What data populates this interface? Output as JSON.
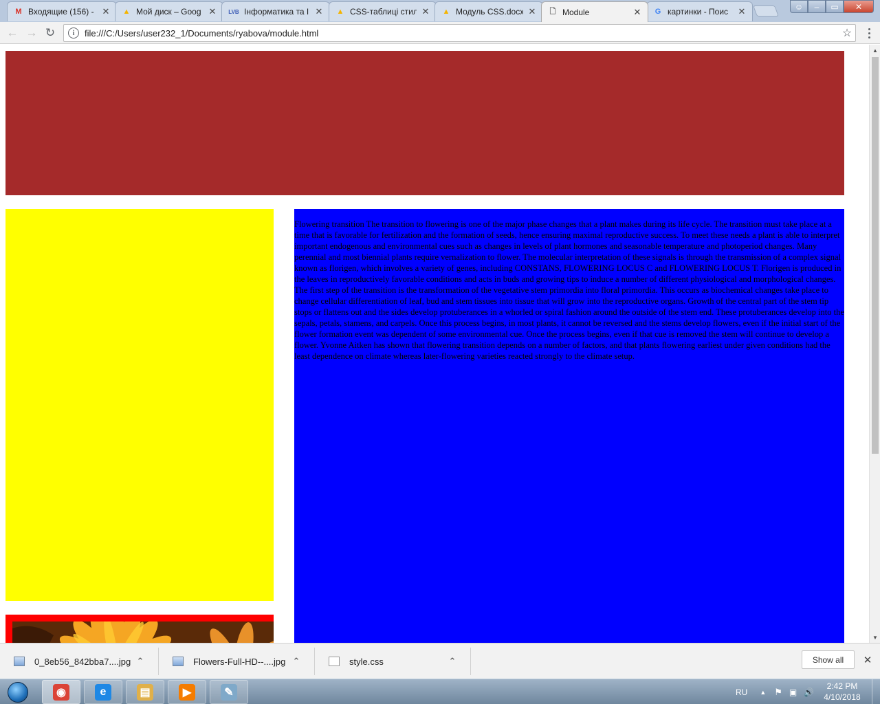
{
  "browser": {
    "tabs": [
      {
        "title": "Входящие (156) -",
        "favicon": "gmail-icon",
        "fav_char": "M",
        "fav_color": "#d93025"
      },
      {
        "title": "Мой диск – Goog",
        "favicon": "google-drive-icon",
        "fav_char": "▲",
        "fav_color": "#f4b400"
      },
      {
        "title": "Інформатика та І",
        "favicon": "lvb-icon",
        "fav_char": "LVB",
        "fav_color": "#3b5bb5"
      },
      {
        "title": "CSS-таблиці стил",
        "favicon": "google-drive-icon",
        "fav_char": "▲",
        "fav_color": "#f4b400"
      },
      {
        "title": "Модуль CSS.docx",
        "favicon": "google-drive-icon",
        "fav_char": "▲",
        "fav_color": "#f4b400"
      },
      {
        "title": "Module",
        "favicon": "document-icon",
        "fav_char": "🗋",
        "fav_color": "#666666"
      },
      {
        "title": "картинки - Поис",
        "favicon": "google-icon",
        "fav_char": "G",
        "fav_color": "#4285f4"
      }
    ],
    "active_tab_index": 5,
    "address": "file:///C:/Users/user232_1/Documents/ryabova/module.html"
  },
  "page": {
    "colors": {
      "header": "#a52a2a",
      "sidebar": "#ffff00",
      "content": "#0000ff",
      "image_frame": "#ff0000"
    },
    "content_text": "Flowering transition The transition to flowering is one of the major phase changes that a plant makes during its life cycle. The transition must take place at a time that is favorable for fertilization and the formation of seeds, hence ensuring maximal reproductive success. To meet these needs a plant is able to interpret important endogenous and environmental cues such as changes in levels of plant hormones and seasonable temperature and photoperiod changes. Many perennial and most biennial plants require vernalization to flower. The molecular interpretation of these signals is through the transmission of a complex signal known as florigen, which involves a variety of genes, including CONSTANS, FLOWERING LOCUS C and FLOWERING LOCUS T. Florigen is produced in the leaves in reproductively favorable conditions and acts in buds and growing tips to induce a number of different physiological and morphological changes. The first step of the transition is the transformation of the vegetative stem primordia into floral primordia. This occurs as biochemical changes take place to change cellular differentiation of leaf, bud and stem tissues into tissue that will grow into the reproductive organs. Growth of the central part of the stem tip stops or flattens out and the sides develop protuberances in a whorled or spiral fashion around the outside of the stem end. These protuberances develop into the sepals, petals, stamens, and carpels. Once this process begins, in most plants, it cannot be reversed and the stems develop flowers, even if the initial start of the flower formation event was dependent of some environmental cue. Once the process begins, even if that cue is removed the stem will continue to develop a flower. Yvonne Aitken has shown that flowering transition depends on a number of factors, and that plants flowering earliest under given conditions had the least dependence on climate whereas later-flowering varieties reacted strongly to the climate setup."
  },
  "downloads": {
    "items": [
      {
        "name": "0_8eb56_842bba7....jpg",
        "type": "image"
      },
      {
        "name": "Flowers-Full-HD--....jpg",
        "type": "image"
      },
      {
        "name": "style.css",
        "type": "css"
      }
    ],
    "show_all_label": "Show all"
  },
  "taskbar": {
    "apps": [
      {
        "name": "chrome-icon",
        "char": "◉",
        "color": "#db4437"
      },
      {
        "name": "internet-explorer-icon",
        "char": "e",
        "color": "#1e88e5"
      },
      {
        "name": "file-explorer-icon",
        "char": "▤",
        "color": "#e0b04a"
      },
      {
        "name": "media-player-icon",
        "char": "▶",
        "color": "#f57c00"
      },
      {
        "name": "notepad-icon",
        "char": "✎",
        "color": "#7fa9c9"
      }
    ],
    "language": "RU",
    "time": "2:42 PM",
    "date": "4/10/2018"
  }
}
